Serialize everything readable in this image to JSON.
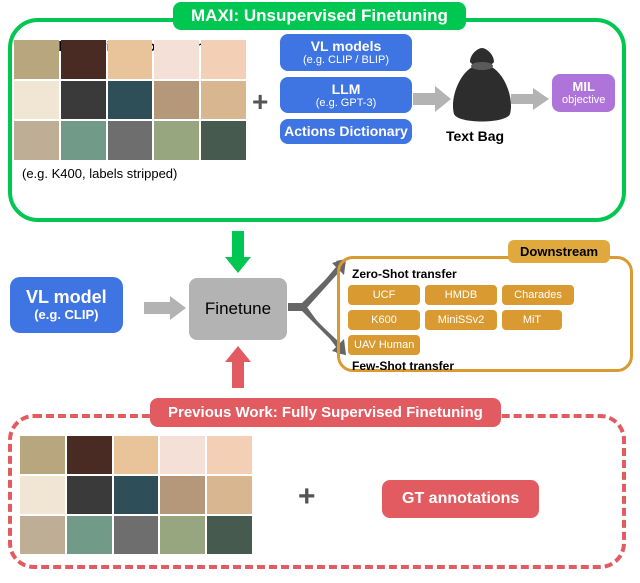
{
  "top": {
    "title": "MAXI: Unsupervised Finetuning",
    "unlabeled_title": "Unlabeled video collection",
    "unlabeled_caption": "(e.g. K400, labels stripped)",
    "plus": "+",
    "blocks": {
      "vl": {
        "title": "VL models",
        "sub": "(e.g. CLIP / BLIP)"
      },
      "llm": {
        "title": "LLM",
        "sub": "(e.g. GPT-3)"
      },
      "dict": {
        "title": "Actions Dictionary",
        "sub": ""
      }
    },
    "bag_label": "Text Bag",
    "mil": {
      "title": "MIL",
      "sub": "objective"
    }
  },
  "middle": {
    "vl": {
      "title": "VL model",
      "sub": "(e.g. CLIP)"
    },
    "finetune": "Finetune",
    "downstream_tag": "Downstream",
    "zs_title": "Zero-Shot transfer",
    "fs_title": "Few-Shot transfer",
    "datasets": [
      "UCF",
      "HMDB",
      "Charades",
      "K600",
      "MiniSSv2",
      "MiT",
      "UAV Human"
    ]
  },
  "bottom": {
    "title": "Previous Work: Fully Supervised Finetuning",
    "plus": "+",
    "gt": "GT annotations"
  }
}
